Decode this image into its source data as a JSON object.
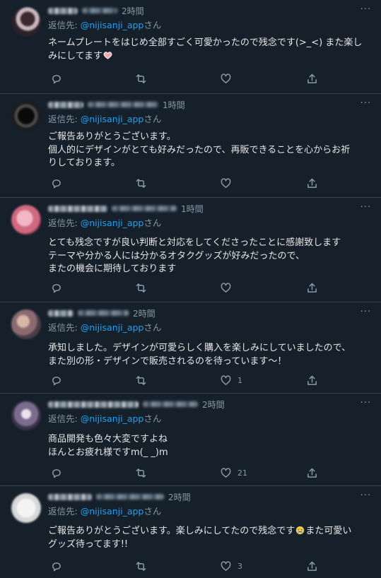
{
  "colors": {
    "background": "#15202b",
    "divider": "#38444d",
    "muted": "#8899a6",
    "mention": "#1da1f2",
    "text": "#e6e6e6"
  },
  "icons": {
    "more": "more-icon",
    "reply": "reply-icon",
    "retweet": "retweet-icon",
    "like": "heart-icon",
    "share": "share-icon"
  },
  "reply_prefix": "返信先: ",
  "reply_suffix": "さん",
  "more_glyph": "···",
  "tweets": [
    {
      "time": "2時間",
      "reply_to": "@nijisanji_app",
      "lines": [
        "ネームプレートをはじめ全部すごく可愛かったので残念です(>_<) また楽し",
        "みにしてます"
      ],
      "likes": ""
    },
    {
      "time": "1時間",
      "reply_to": "",
      "lines": [
        "ご報告ありがとうございます。",
        "個人的にデザインがとても好みだったので、再販できることを心からお祈",
        "りしております。"
      ],
      "likes": ""
    },
    {
      "time": "1時間",
      "reply_to": "@nijisanji_app",
      "lines": [
        "とても残念ですが良い判断と対応をしてくださったことに感謝致します",
        "テーマや分かる人には分かるオタクグッズが好みだったので、",
        "またの機会に期待しております"
      ],
      "likes": ""
    },
    {
      "time": "2時間",
      "reply_to": "@nijisanji_app",
      "lines": [
        "承知しました。デザインが可愛らしく購入を楽しみにしていましたので、",
        "また別の形・デザインで販売されるのを待っています～！"
      ],
      "likes": "1"
    },
    {
      "time": "2時間",
      "reply_to": "@nijisanji_app",
      "lines": [
        "商品開発も色々大変ですよね",
        "ほんとお疲れ様ですm(_ _)m"
      ],
      "likes": "21"
    },
    {
      "time": "2時間",
      "reply_to": "@nijisanji_app",
      "lines": [
        "ご報告ありがとうございます。楽しみにしてたので残念です",
        "また可愛い",
        "グッズ待ってます!!"
      ],
      "likes": "3"
    }
  ]
}
